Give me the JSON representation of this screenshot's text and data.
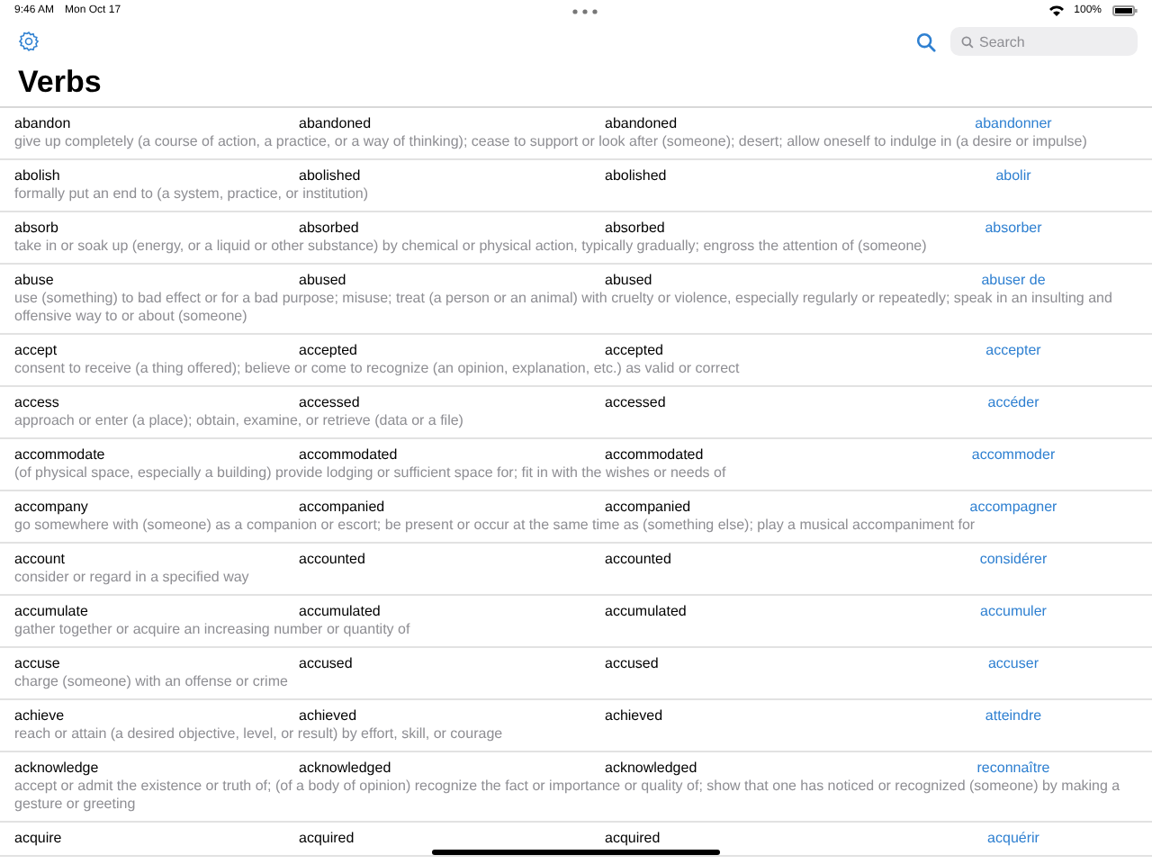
{
  "status_bar": {
    "time": "9:46 AM",
    "date": "Mon Oct 17",
    "battery": "100%"
  },
  "search": {
    "placeholder": "Search"
  },
  "title": "Verbs",
  "rows": [
    {
      "infinitive": "abandon",
      "past": "abandoned",
      "participle": "abandoned",
      "translation": "abandonner",
      "definition": "give up completely (a course of action, a practice, or a way of thinking); cease to support or look after (someone); desert; allow oneself to indulge in (a desire or impulse)"
    },
    {
      "infinitive": "abolish",
      "past": "abolished",
      "participle": "abolished",
      "translation": "abolir",
      "definition": "formally put an end to (a system, practice, or institution)"
    },
    {
      "infinitive": "absorb",
      "past": "absorbed",
      "participle": "absorbed",
      "translation": "absorber",
      "definition": "take in or soak up (energy, or a liquid or other substance) by chemical or physical action, typically gradually; engross the attention of (someone)"
    },
    {
      "infinitive": "abuse",
      "past": "abused",
      "participle": "abused",
      "translation": "abuser de",
      "definition": "use (something) to bad effect or for a bad purpose; misuse; treat (a person or an animal) with cruelty or violence, especially regularly or repeatedly; speak in an insulting and offensive way to or about (someone)"
    },
    {
      "infinitive": "accept",
      "past": "accepted",
      "participle": "accepted",
      "translation": "accepter",
      "definition": "consent to receive (a thing offered); believe or come to recognize (an opinion, explanation, etc.) as valid or correct"
    },
    {
      "infinitive": "access",
      "past": "accessed",
      "participle": "accessed",
      "translation": "accéder",
      "definition": "approach or enter (a place); obtain, examine, or retrieve (data or a file)"
    },
    {
      "infinitive": "accommodate",
      "past": "accommodated",
      "participle": "accommodated",
      "translation": "accommoder",
      "definition": "(of physical space, especially a building) provide lodging or sufficient space for; fit in with the wishes or needs of"
    },
    {
      "infinitive": "accompany",
      "past": "accompanied",
      "participle": "accompanied",
      "translation": "accompagner",
      "definition": "go somewhere with (someone) as a companion or escort; be present or occur at the same time as (something else); play a musical accompaniment for"
    },
    {
      "infinitive": "account",
      "past": "accounted",
      "participle": "accounted",
      "translation": "considérer",
      "definition": "consider or regard in a specified way"
    },
    {
      "infinitive": "accumulate",
      "past": "accumulated",
      "participle": "accumulated",
      "translation": "accumuler",
      "definition": "gather together or acquire an increasing number or quantity of"
    },
    {
      "infinitive": "accuse",
      "past": "accused",
      "participle": "accused",
      "translation": "accuser",
      "definition": "charge (someone) with an offense or crime"
    },
    {
      "infinitive": "achieve",
      "past": "achieved",
      "participle": "achieved",
      "translation": "atteindre",
      "definition": "reach or attain (a desired objective, level, or result) by effort, skill, or courage"
    },
    {
      "infinitive": "acknowledge",
      "past": "acknowledged",
      "participle": "acknowledged",
      "translation": "reconnaître",
      "definition": "accept or admit the existence or truth of; (of a body of opinion) recognize the fact or importance or quality of; show that one has noticed or recognized (someone) by making a gesture or greeting"
    },
    {
      "infinitive": "acquire",
      "past": "acquired",
      "participle": "acquired",
      "translation": "acquérir"
    }
  ]
}
